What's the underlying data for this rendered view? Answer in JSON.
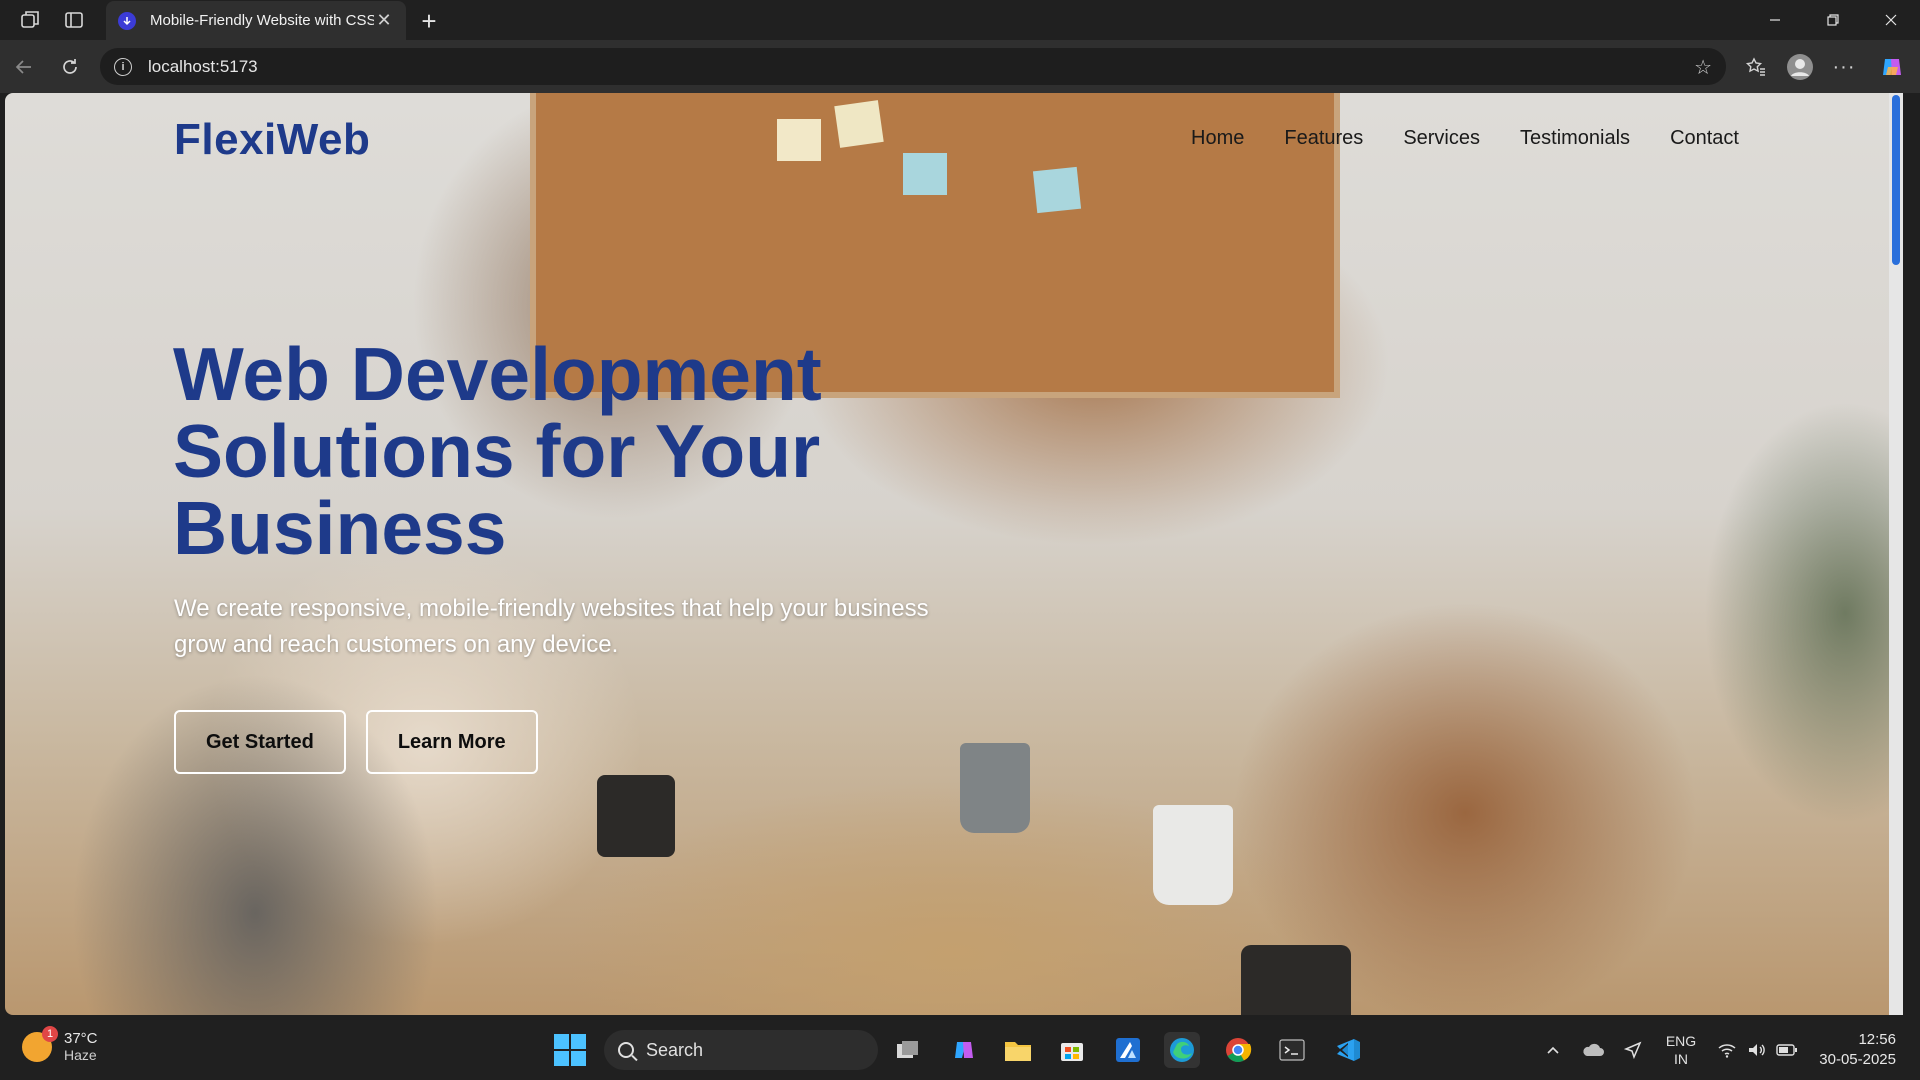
{
  "browser": {
    "tab_title": "Mobile-Friendly Website with CSS",
    "url": "localhost:5173"
  },
  "site": {
    "logo": "FlexiWeb",
    "nav": [
      "Home",
      "Features",
      "Services",
      "Testimonials",
      "Contact"
    ],
    "hero_title": "Web Development Solutions for Your Business",
    "hero_text": "We create responsive, mobile-friendly websites that help your business grow and reach customers on any device.",
    "buttons": {
      "primary": "Get Started",
      "secondary": "Learn More"
    },
    "colors": {
      "brand": "#1e3a8a"
    }
  },
  "taskbar": {
    "weather_temp": "37°C",
    "weather_desc": "Haze",
    "weather_badge": "1",
    "search_label": "Search",
    "lang_1": "ENG",
    "lang_2": "IN",
    "time": "12:56",
    "date": "30-05-2025"
  }
}
